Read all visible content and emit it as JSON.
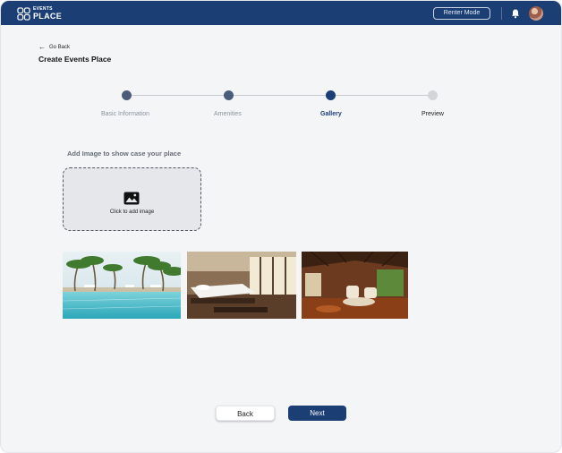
{
  "brand": {
    "line1": "EVENTS",
    "line2": "PLACE",
    "color": "#1b3f75"
  },
  "topbar": {
    "renter_mode_label": "Renter Mode",
    "bell_icon": "bell-icon",
    "avatar_icon": "user-avatar"
  },
  "header": {
    "go_back_label": "Go Back",
    "page_title": "Create Events Place"
  },
  "stepper": {
    "steps": [
      {
        "label": "Basic Information",
        "state": "done"
      },
      {
        "label": "Amenities",
        "state": "done"
      },
      {
        "label": "Gallery",
        "state": "active"
      },
      {
        "label": "Preview",
        "state": "pending"
      }
    ],
    "done_color": "#4b5c78",
    "active_color": "#1b3f75",
    "pending_color": "#d3d5d9"
  },
  "upload": {
    "heading": "Add Image to show case your place",
    "dropzone_label": "Click to add image",
    "icon": "image-icon"
  },
  "gallery": {
    "images": [
      {
        "name": "pool-with-palm-trees"
      },
      {
        "name": "hotel-bedroom"
      },
      {
        "name": "wooden-lounge-interior"
      }
    ]
  },
  "footer": {
    "back_label": "Back",
    "next_label": "Next"
  }
}
